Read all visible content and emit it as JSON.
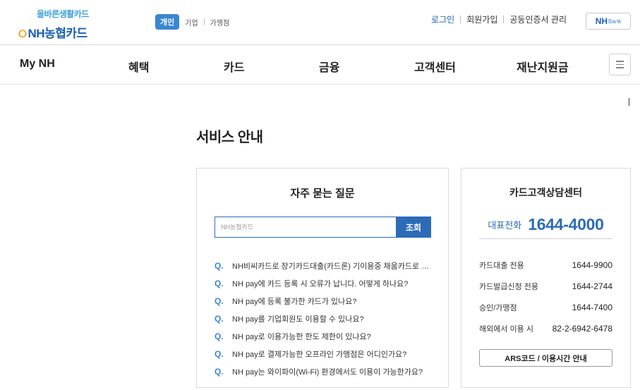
{
  "logo": {
    "slogan": "올바른생활카드",
    "name": "NH농협카드"
  },
  "segments": {
    "personal": "개인",
    "corporate": "기업",
    "merchant": "가맹점"
  },
  "util": {
    "login": "로그인",
    "join": "회원가입",
    "cert": "공동인증서 관리"
  },
  "nhbank": {
    "nh": "NH",
    "bank": "Bank"
  },
  "gnb": {
    "items": [
      "My NH",
      "혜택",
      "카드",
      "금융",
      "고객센터",
      "재난지원금"
    ]
  },
  "page": {
    "title": "서비스 안내"
  },
  "faq": {
    "title": "자주 묻는 질문",
    "search_placeholder": "NH농협카드",
    "search_button": "조회",
    "q_mark": "Q.",
    "items": [
      "NH비씨카드로 장기카드대출(카드론) 기이용중 채움카드로 추가 이용이 가능한가요?",
      "NH pay에 카드 등록 시 오류가 납니다. 어떻게 하나요?",
      "NH pay에 등록 불가한 카드가 있나요?",
      "NH pay를 기업회원도 이용할 수 있나요?",
      "NH pay로 이용가능한 한도 제한이 있나요?",
      "NH pay로 결제가능한 오프라인 가맹점은 어디인가요?",
      "NH pay는 와이파이(Wi-Fi) 환경에서도 이용이 가능한가요?"
    ]
  },
  "cs": {
    "title": "카드고객상담센터",
    "main_label": "대표전화",
    "main_number": "1644-4000",
    "rows": [
      {
        "label": "카드대출 전용",
        "number": "1644-9900"
      },
      {
        "label": "카드발급신청 전용",
        "number": "1644-2744"
      },
      {
        "label": "승인/가맹점",
        "number": "1644-7400"
      },
      {
        "label": "해외에서 이용 시",
        "number": "82-2-6942-6478"
      }
    ],
    "ars_button": "ARS코드 / 이용시간 안내"
  },
  "colors": {
    "brand_blue": "#2c6bb7",
    "accent_blue": "#3b86d0",
    "logo_orange": "#f2a51a"
  }
}
